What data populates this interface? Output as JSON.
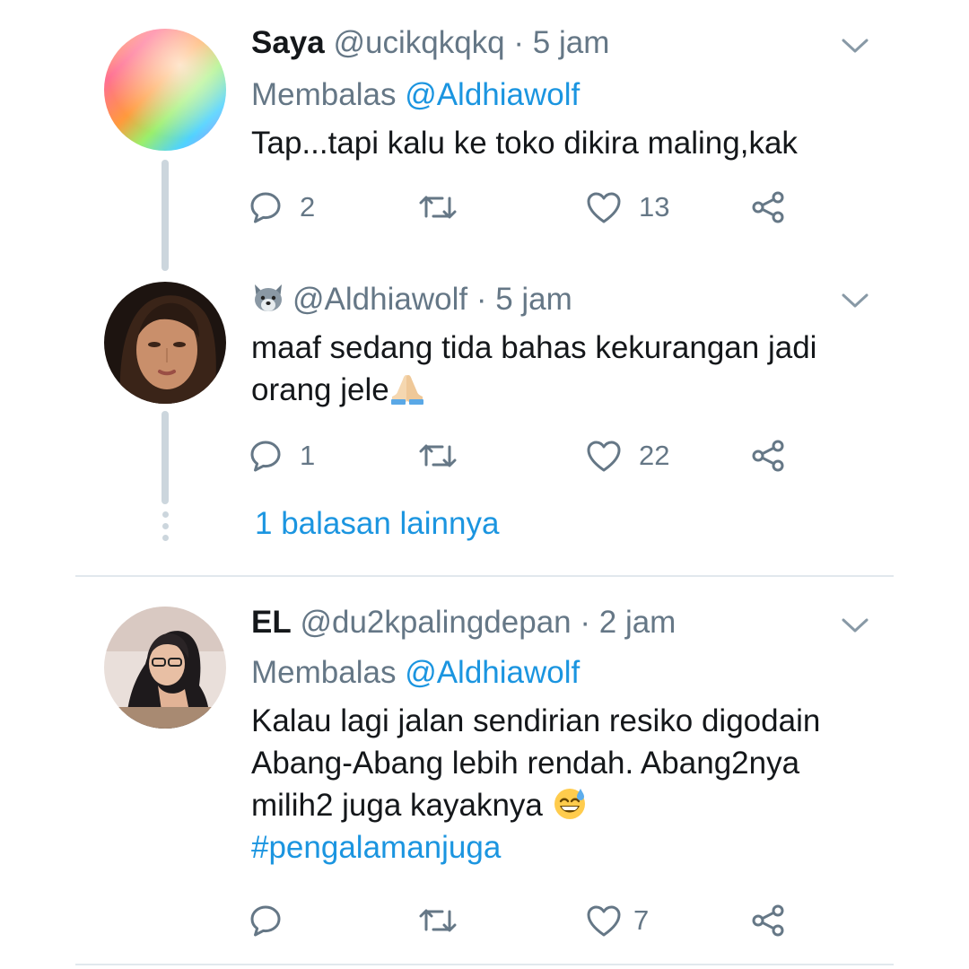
{
  "tweets": [
    {
      "display_name": "Saya",
      "handle": "@ucikqkqkq",
      "time": "· 5 jam",
      "reply_prefix": "Membalas",
      "reply_to": "@Aldhiawolf",
      "text": "Tap...tapi kalu ke toko dikira maling,kak",
      "replies": "2",
      "likes": "13",
      "avatar": "rainbow-gradient"
    },
    {
      "display_name_emoji": "wolf-emoji",
      "handle": "@Aldhiawolf",
      "time": "· 5 jam",
      "text_line1": "maaf sedang tida bahas kekurangan jadi",
      "text_line2": "orang jele",
      "trailing_emoji": "folded-hands-emoji",
      "replies": "1",
      "likes": "22",
      "avatar": "woman-portrait"
    },
    {
      "display_name": "EL",
      "handle": "@du2kpalingdepan",
      "time": "· 2 jam",
      "reply_prefix": "Membalas",
      "reply_to": "@Aldhiawolf",
      "text_line1": "Kalau lagi jalan sendirian resiko digodain",
      "text_line2": "Abang-Abang lebih rendah. Abang2nya",
      "text_line3": "milih2 juga kayaknya",
      "trailing_emoji": "grinning-sweat-emoji",
      "hashtag": "#pengalamanjuga",
      "likes": "7",
      "avatar": "hijab-portrait"
    }
  ],
  "thread": {
    "more_replies_label": "1 balasan lainnya"
  },
  "colors": {
    "text": "#14171a",
    "secondary": "#657786",
    "link": "#1b95e0",
    "thread_line": "#ccd6dd",
    "divider": "#e1e8ed"
  }
}
